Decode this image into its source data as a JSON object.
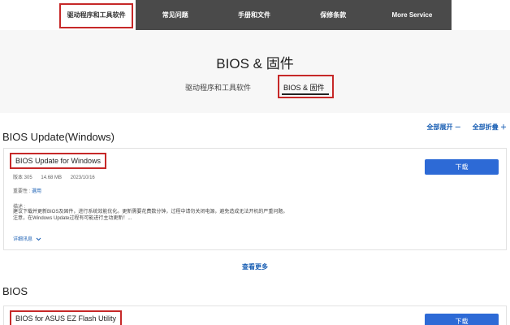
{
  "nav": {
    "tabs": [
      {
        "label": "驱动程序和工具软件"
      },
      {
        "label": "常见问题"
      },
      {
        "label": "手册和文件"
      },
      {
        "label": "保修条款"
      },
      {
        "label": "More Service"
      }
    ]
  },
  "header": {
    "title": "BIOS & 固件",
    "subtabs": [
      {
        "label": "驱动程序和工具软件"
      },
      {
        "label": "BIOS & 固件"
      }
    ]
  },
  "sections": {
    "windows": {
      "title": "BIOS Update(Windows)",
      "expand_all": "全部展开 －",
      "collapse_all": "全部折叠 ＋",
      "card": {
        "title": "BIOS Update for Windows",
        "version": "版本 305",
        "size": "14.68 MB",
        "date": "2023/10/16",
        "importance_label": "重要性 : ",
        "importance_value": "選用",
        "desc_label": "描述 :",
        "desc_line1": "建议下载并更新BIOS及固件，进行系统效能优化。更新需要花费数分钟，过程中请勿关闭电源，避免造成无法开机的严重问题。",
        "desc_line2": "注意，在Windows Update过程有可能进行主动更新！...",
        "details": "详细讯息",
        "download": "下载"
      },
      "view_more": "查看更多"
    },
    "bios": {
      "title": "BIOS",
      "card": {
        "title": "BIOS for ASUS EZ Flash Utility",
        "download": "下载"
      }
    }
  }
}
